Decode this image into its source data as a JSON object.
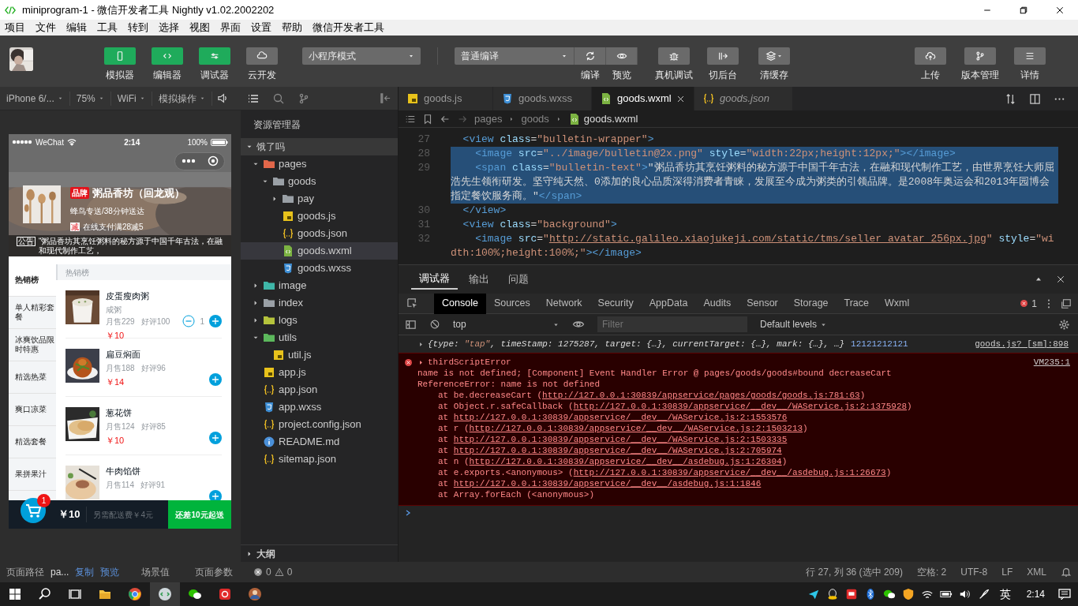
{
  "window": {
    "title": "miniprogram-1 - 微信开发者工具 Nightly v1.02.2002202"
  },
  "menu": [
    "项目",
    "文件",
    "编辑",
    "工具",
    "转到",
    "选择",
    "视图",
    "界面",
    "设置",
    "帮助",
    "微信开发者工具"
  ],
  "toolbar": {
    "left": [
      {
        "label": "模拟器",
        "kind": "phone",
        "on": true
      },
      {
        "label": "编辑器",
        "kind": "code",
        "on": true
      },
      {
        "label": "调试器",
        "kind": "sliders",
        "on": true
      },
      {
        "label": "云开发",
        "kind": "cloud",
        "on": false
      }
    ],
    "mode": "小程序模式",
    "compile": "普通编译",
    "actions": [
      {
        "label": "编译",
        "kind": "refresh"
      },
      {
        "label": "预览",
        "kind": "eye"
      },
      {
        "label": "真机调试",
        "kind": "bug"
      },
      {
        "label": "切后台",
        "kind": "switch"
      },
      {
        "label": "清缓存",
        "kind": "layers"
      }
    ],
    "right": [
      {
        "label": "上传",
        "kind": "upload"
      },
      {
        "label": "版本管理",
        "kind": "branch"
      },
      {
        "label": "详情",
        "kind": "menu"
      }
    ]
  },
  "simulator_toolbar": [
    "iPhone 6/...",
    "75%",
    "WiFi",
    "模拟操作"
  ],
  "phone": {
    "carrier": "WeChat",
    "time": "2:14",
    "battery": "100%",
    "shop": {
      "brand": "品牌",
      "name": "粥品香坊（回龙观）",
      "delivery": "蜂鸟专送/38分钟送达",
      "support_badge": "减",
      "support": "在线支付满28减5",
      "bulletin_badge": "公告",
      "bulletin": "“粥品香坊其烹饪粥料的秘方源于中国千年古法，在融和现代制作工艺，"
    },
    "menu": [
      {
        "label": "热销榜",
        "selected": true
      },
      {
        "label": "单人精彩套餐",
        "selected": false
      },
      {
        "label": "冰爽饮品限时特惠",
        "selected": false
      },
      {
        "label": "精选热菜",
        "selected": false
      },
      {
        "label": "爽口凉菜",
        "selected": false
      },
      {
        "label": "精选套餐",
        "selected": false
      },
      {
        "label": "果拼果汁",
        "selected": false
      }
    ],
    "section": "热销榜",
    "foods": [
      {
        "name": "皮蛋瘦肉粥",
        "description": "咸粥",
        "sales": "月售229",
        "rating": "好评100",
        "price": "￥10",
        "count": "1"
      },
      {
        "name": "扁豆焖面",
        "sales": "月售188",
        "rating": "好评96",
        "price": "￥14"
      },
      {
        "name": "葱花饼",
        "sales": "月售124",
        "rating": "好评85",
        "price": "￥10"
      },
      {
        "name": "牛肉馅饼",
        "sales": "月售114",
        "rating": "好评91"
      }
    ],
    "cart": {
      "count": "1",
      "total": "￥10",
      "delivery": "另需配送费￥4元",
      "pay": "还差10元起送"
    }
  },
  "explorer": {
    "title": "资源管理器",
    "project": "饿了吗",
    "outline": "大纲",
    "tree": [
      {
        "label": "pages",
        "kind": "folder",
        "color": "#e2674a",
        "expanded": true,
        "selected": false,
        "children": [
          {
            "label": "goods",
            "kind": "folder",
            "color": "#9aa0a6",
            "expanded": true,
            "selected": false,
            "children": [
              {
                "label": "pay",
                "kind": "folder",
                "color": "#9aa0a6",
                "expanded": false,
                "selected": false
              },
              {
                "label": "goods.js",
                "kind": "js",
                "selected": false
              },
              {
                "label": "goods.json",
                "kind": "json",
                "selected": false
              },
              {
                "label": "goods.wxml",
                "kind": "wxml",
                "selected": true
              },
              {
                "label": "goods.wxss",
                "kind": "wxss",
                "selected": false
              }
            ]
          }
        ]
      },
      {
        "label": "image",
        "kind": "folder",
        "color": "#3fb6a8",
        "expanded": false,
        "selected": false
      },
      {
        "label": "index",
        "kind": "folder",
        "color": "#9aa0a6",
        "expanded": false,
        "selected": false
      },
      {
        "label": "logs",
        "kind": "folder",
        "color": "#b5c33c",
        "expanded": false,
        "selected": false
      },
      {
        "label": "utils",
        "kind": "folder",
        "color": "#5cb85c",
        "expanded": true,
        "selected": false,
        "children": [
          {
            "label": "util.js",
            "kind": "js",
            "selected": false
          }
        ]
      },
      {
        "label": "app.js",
        "kind": "js",
        "selected": false
      },
      {
        "label": "app.json",
        "kind": "json",
        "selected": false
      },
      {
        "label": "app.wxss",
        "kind": "wxss",
        "selected": false
      },
      {
        "label": "project.config.json",
        "kind": "json",
        "selected": false
      },
      {
        "label": "README.md",
        "kind": "md",
        "selected": false
      },
      {
        "label": "sitemap.json",
        "kind": "json",
        "selected": false
      }
    ]
  },
  "editor": {
    "tabs": [
      {
        "label": "goods.js",
        "kind": "js",
        "selected": false,
        "preview": false
      },
      {
        "label": "goods.wxss",
        "kind": "wxss",
        "selected": false,
        "preview": false
      },
      {
        "label": "goods.wxml",
        "kind": "wxml",
        "selected": true,
        "preview": false
      },
      {
        "label": "goods.json",
        "kind": "json",
        "selected": false,
        "preview": true
      }
    ],
    "breadcrumb": [
      "pages",
      "goods",
      "goods.wxml"
    ],
    "lines": [
      {
        "number": "27",
        "selected": false,
        "tokens": [
          {
            "kind": "tag",
            "text": "  <view"
          },
          {
            "kind": "attr",
            "text": " class"
          },
          {
            "kind": "text",
            "text": "="
          },
          {
            "kind": "str",
            "text": "\"bulletin-wrapper\""
          },
          {
            "kind": "tag",
            "text": ">"
          }
        ]
      },
      {
        "number": "28",
        "selected": true,
        "tokens": [
          {
            "kind": "tag",
            "text": "    <image"
          },
          {
            "kind": "attr",
            "text": " src"
          },
          {
            "kind": "text",
            "text": "="
          },
          {
            "kind": "str",
            "text": "\"../image/bulletin@2x.png\""
          },
          {
            "kind": "attr",
            "text": " style"
          },
          {
            "kind": "text",
            "text": "="
          },
          {
            "kind": "str",
            "text": "\"width:22px;height:12px;\""
          },
          {
            "kind": "tag",
            "text": "></image>"
          }
        ]
      },
      {
        "number": "29",
        "selected": true,
        "tokens": [
          {
            "kind": "tag",
            "text": "    <span"
          },
          {
            "kind": "attr",
            "text": " class"
          },
          {
            "kind": "text",
            "text": "="
          },
          {
            "kind": "str",
            "text": "\"bulletin-text\""
          },
          {
            "kind": "tag",
            "text": ">"
          },
          {
            "kind": "text",
            "text": "\"粥品香坊其烹饪粥料的秘方源于中国千年古法，在融和现代制作工艺，由世界烹饪大师屈浩先生领衔研发。坚守纯天然、0添加的良心品质深得消费者青睐，发展至今成为粥类的引领品牌。是2008年奥运会和2013年园博会指定餐饮服务商。\""
          },
          {
            "kind": "tag",
            "text": "</span>"
          }
        ]
      },
      {
        "number": "30",
        "selected": false,
        "tokens": [
          {
            "kind": "tag",
            "text": "  </view>"
          }
        ]
      },
      {
        "number": "31",
        "selected": false,
        "tokens": [
          {
            "kind": "tag",
            "text": "  <view"
          },
          {
            "kind": "attr",
            "text": " class"
          },
          {
            "kind": "text",
            "text": "="
          },
          {
            "kind": "str",
            "text": "\"background\""
          },
          {
            "kind": "tag",
            "text": ">"
          }
        ]
      },
      {
        "number": "32",
        "selected": false,
        "tokens": [
          {
            "kind": "tag",
            "text": "    <image"
          },
          {
            "kind": "attr",
            "text": " src"
          },
          {
            "kind": "text",
            "text": "="
          },
          {
            "kind": "str",
            "text": "\""
          },
          {
            "kind": "link",
            "text": "http://static.galileo.xiaojukeji.com/static/tms/seller_avatar_256px.jpg"
          },
          {
            "kind": "str",
            "text": "\""
          },
          {
            "kind": "attr",
            "text": " style"
          },
          {
            "kind": "text",
            "text": "="
          },
          {
            "kind": "str",
            "text": "\"width:100%;height:100%;\""
          },
          {
            "kind": "tag",
            "text": "></image>"
          }
        ]
      }
    ]
  },
  "devtools": {
    "panels": [
      {
        "label": "调试器",
        "selected": true
      },
      {
        "label": "输出",
        "selected": false
      },
      {
        "label": "问题",
        "selected": false
      }
    ],
    "tabs": [
      {
        "label": "Console",
        "selected": true
      },
      {
        "label": "Sources",
        "selected": false
      },
      {
        "label": "Network",
        "selected": false
      },
      {
        "label": "Security",
        "selected": false
      },
      {
        "label": "AppData",
        "selected": false
      },
      {
        "label": "Audits",
        "selected": false
      },
      {
        "label": "Sensor",
        "selected": false
      },
      {
        "label": "Storage",
        "selected": false
      },
      {
        "label": "Trace",
        "selected": false
      },
      {
        "label": "Wxml",
        "selected": false
      }
    ],
    "error_count": "1",
    "context": "top",
    "filter_placeholder": "Filter",
    "levels": "Default levels",
    "log": {
      "preview": [
        {
          "kind": "key",
          "text": "{type: "
        },
        {
          "kind": "str",
          "text": "\"tap\""
        },
        {
          "kind": "key",
          "text": ", timeStamp: 1275287, target: {…}, currentTarget: {…}, mark: {…}, …}"
        }
      ],
      "message": "12121212121",
      "source": "goods.js? [sm]:898"
    },
    "error": {
      "title": "thirdScriptError",
      "source": "VM235:1",
      "lines": [
        "name is not defined; [Component] Event Handler Error @ pages/goods/goods#bound decreaseCart",
        "ReferenceError: name is not defined"
      ],
      "stack": [
        {
          "prefix": "at be.decreaseCart (",
          "url": "http://127.0.0.1:30839/appservice/pages/goods/goods.js:781:63",
          "suffix": ")"
        },
        {
          "prefix": "at Object.r.safeCallback (",
          "url": "http://127.0.0.1:30839/appservice/__dev__/WAService.js:2:1375928",
          "suffix": ")"
        },
        {
          "prefix": "at ",
          "url": "http://127.0.0.1:30839/appservice/__dev__/WAService.js:2:1553576"
        },
        {
          "prefix": "at r (",
          "url": "http://127.0.0.1:30839/appservice/__dev__/WAService.js:2:1503213",
          "suffix": ")"
        },
        {
          "prefix": "at ",
          "url": "http://127.0.0.1:30839/appservice/__dev__/WAService.js:2:1503335"
        },
        {
          "prefix": "at ",
          "url": "http://127.0.0.1:30839/appservice/__dev__/WAService.js:2:705974"
        },
        {
          "prefix": "at n (",
          "url": "http://127.0.0.1:30839/appservice/__dev__/asdebug.js:1:26304",
          "suffix": ")"
        },
        {
          "prefix": "at e.exports.<anonymous> (",
          "url": "http://127.0.0.1:30839/appservice/__dev__/asdebug.js:1:26673",
          "suffix": ")"
        },
        {
          "prefix": "at ",
          "url": "http://127.0.0.1:30839/appservice/__dev__/asdebug.js:1:1846"
        },
        {
          "prefix": "at Array.forEach (<anonymous>)"
        }
      ]
    }
  },
  "status_bar": {
    "path_label": "页面路径",
    "path": "pa...",
    "copy": "复制",
    "preview": "预览",
    "scene": "场景值",
    "params": "页面参数",
    "errors": "0",
    "warnings": "0",
    "position": "行 27, 列 36 (选中 209)",
    "spaces": "空格: 2",
    "encoding": "UTF-8",
    "eol": "LF",
    "language": "XML"
  },
  "taskbar": {
    "ime": "英",
    "time": "2:14"
  }
}
